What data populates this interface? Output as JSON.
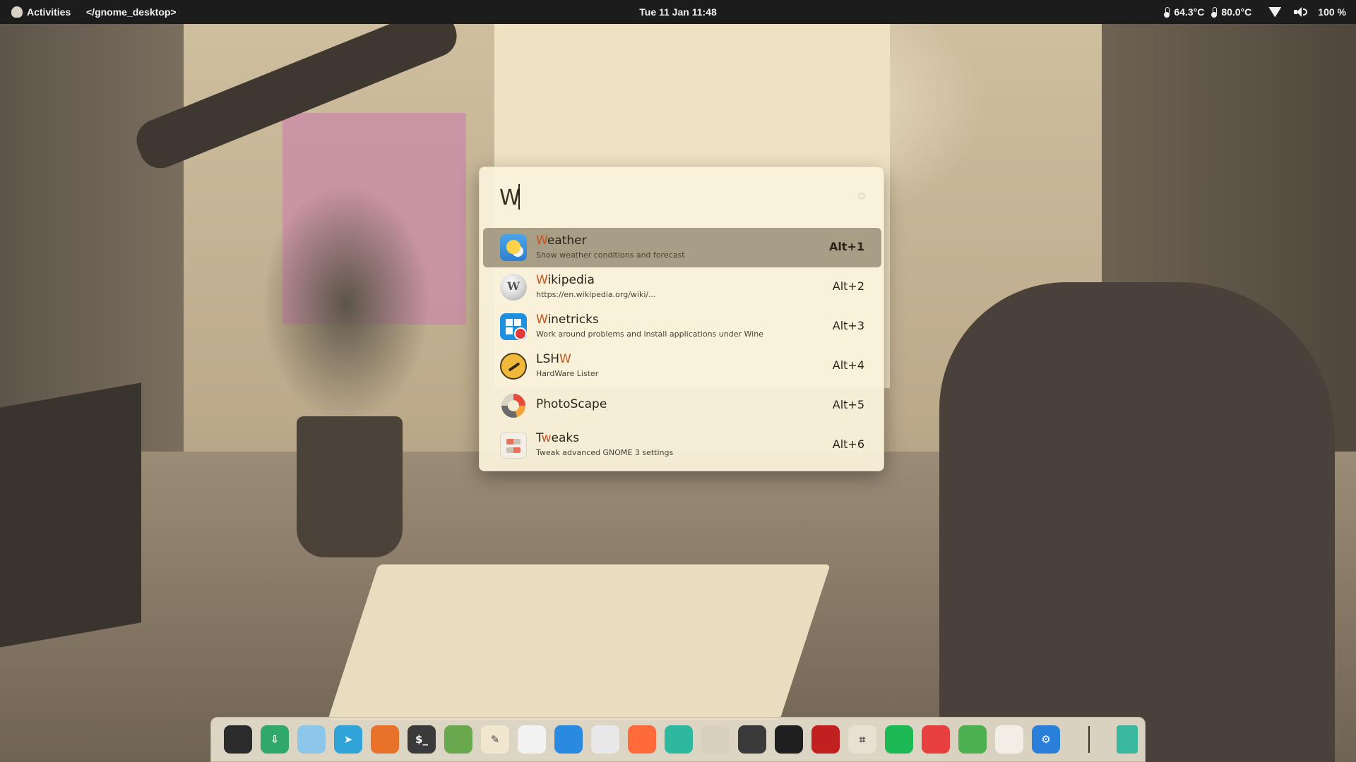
{
  "topbar": {
    "activities_label": "Activities",
    "app_name": "</gnome_desktop>",
    "clock": "Tue 11 Jan  11:48",
    "cpu_temp": "64.3°C",
    "gpu_temp": "80.0°C",
    "volume": "100 %"
  },
  "launcher": {
    "query": "W",
    "results": [
      {
        "name_hl": "W",
        "name_rest": "eather",
        "name_prefix": "",
        "description": "Show weather conditions and forecast",
        "shortcut": "Alt+1",
        "icon": "weather-icon"
      },
      {
        "name_hl": "W",
        "name_rest": "ikipedia",
        "name_prefix": "",
        "description": "https://en.wikipedia.org/wiki/...",
        "shortcut": "Alt+2",
        "icon": "wikipedia-icon"
      },
      {
        "name_hl": "W",
        "name_rest": "inetricks",
        "name_prefix": "",
        "description": "Work around problems and install applications under Wine",
        "shortcut": "Alt+3",
        "icon": "winetricks-icon"
      },
      {
        "name_prefix": "LSH",
        "name_hl": "W",
        "name_rest": "",
        "description": "HardWare Lister",
        "shortcut": "Alt+4",
        "icon": "lshw-icon"
      },
      {
        "name_prefix": "PhotoScape",
        "name_hl": "",
        "name_rest": "",
        "description": "",
        "shortcut": "Alt+5",
        "icon": "photoscape-icon"
      },
      {
        "name_prefix": "T",
        "name_hl": "w",
        "name_rest": "eaks",
        "description": "Tweak advanced GNOME 3 settings",
        "shortcut": "Alt+6",
        "icon": "tweaks-icon"
      }
    ]
  },
  "dock": {
    "apps": [
      {
        "icon": "penguin-app-icon",
        "color": "#2b2b2b",
        "glyph": ""
      },
      {
        "icon": "download-manager-icon",
        "color": "#2fa86a",
        "glyph": "⇩"
      },
      {
        "icon": "files-icon",
        "color": "#8cc6e8",
        "glyph": ""
      },
      {
        "icon": "telegram-icon",
        "color": "#2fa3d8",
        "glyph": "➤"
      },
      {
        "icon": "firefox-icon",
        "color": "#e8722a",
        "glyph": ""
      },
      {
        "icon": "terminal-icon",
        "color": "#3a3a3a",
        "glyph": "$_"
      },
      {
        "icon": "maps-icon",
        "color": "#6aa84f",
        "glyph": ""
      },
      {
        "icon": "text-editor-icon",
        "color": "#f2e6cf",
        "glyph": "✎"
      },
      {
        "icon": "color-picker-icon",
        "color": "#f2f2f2",
        "glyph": ""
      },
      {
        "icon": "messages-icon",
        "color": "#2a8ae0",
        "glyph": ""
      },
      {
        "icon": "forms-icon",
        "color": "#e8e8e8",
        "glyph": ""
      },
      {
        "icon": "shotwell-icon",
        "color": "#ff6a3a",
        "glyph": ""
      },
      {
        "icon": "screenshot-icon",
        "color": "#2eb8a0",
        "glyph": ""
      },
      {
        "icon": "gimp-icon",
        "color": "#d8cfbf",
        "glyph": ""
      },
      {
        "icon": "inkscape-icon",
        "color": "#3a3a3a",
        "glyph": ""
      },
      {
        "icon": "figma-icon",
        "color": "#1f1f1f",
        "glyph": ""
      },
      {
        "icon": "video-editor-icon",
        "color": "#c02020",
        "glyph": ""
      },
      {
        "icon": "screen-capture-icon",
        "color": "#e8e0d0",
        "glyph": "⌗"
      },
      {
        "icon": "spotify-icon",
        "color": "#1db954",
        "glyph": ""
      },
      {
        "icon": "audio-editor-icon",
        "color": "#e84040",
        "glyph": ""
      },
      {
        "icon": "extensions-icon",
        "color": "#4caf50",
        "glyph": ""
      },
      {
        "icon": "tweaks-icon",
        "color": "#f2eee6",
        "glyph": ""
      },
      {
        "icon": "settings-icon",
        "color": "#2a80d8",
        "glyph": "⚙"
      }
    ],
    "trash": {
      "icon": "trash-icon",
      "color": "#3ab8a0"
    }
  }
}
